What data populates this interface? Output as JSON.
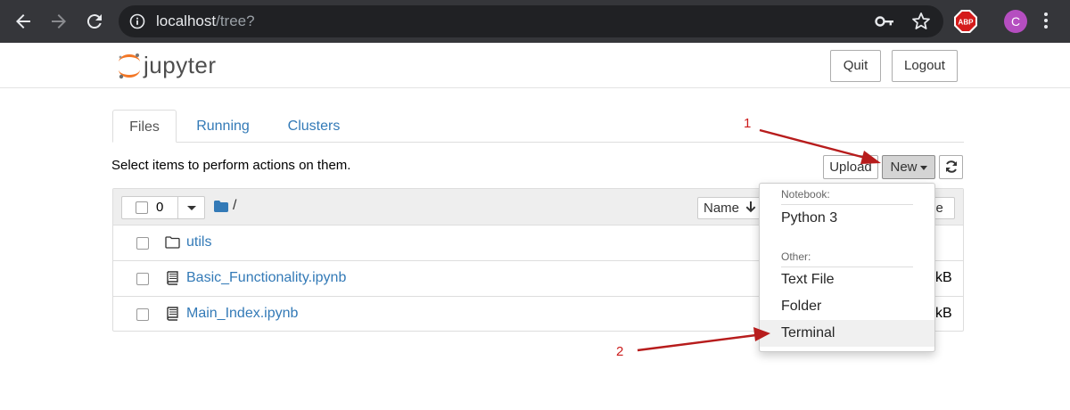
{
  "browser": {
    "url_host": "localhost",
    "url_path": "/tree?",
    "abp_label": "ABP",
    "avatar_letter": "C"
  },
  "header": {
    "logo_text": "jupyter",
    "quit_label": "Quit",
    "logout_label": "Logout"
  },
  "tabs": [
    {
      "label": "Files"
    },
    {
      "label": "Running"
    },
    {
      "label": "Clusters"
    }
  ],
  "toolbar": {
    "instruction": "Select items to perform actions on them.",
    "upload_label": "Upload",
    "new_label": "New"
  },
  "list_header": {
    "selected_count": "0",
    "breadcrumb": "/",
    "sort_name_label": "Name",
    "sort_size_label": "ze"
  },
  "files": [
    {
      "name": "utils",
      "type": "folder",
      "size": ""
    },
    {
      "name": "Basic_Functionality.ipynb",
      "type": "notebook",
      "size": "kB"
    },
    {
      "name": "Main_Index.ipynb",
      "type": "notebook",
      "size": "kB"
    }
  ],
  "new_menu": {
    "notebook_header": "Notebook:",
    "python_label": "Python 3",
    "other_header": "Other:",
    "text_file_label": "Text File",
    "folder_label": "Folder",
    "terminal_label": "Terminal"
  },
  "annotations": {
    "step1": "1",
    "step2": "2",
    "color": "#cc1b1b"
  }
}
